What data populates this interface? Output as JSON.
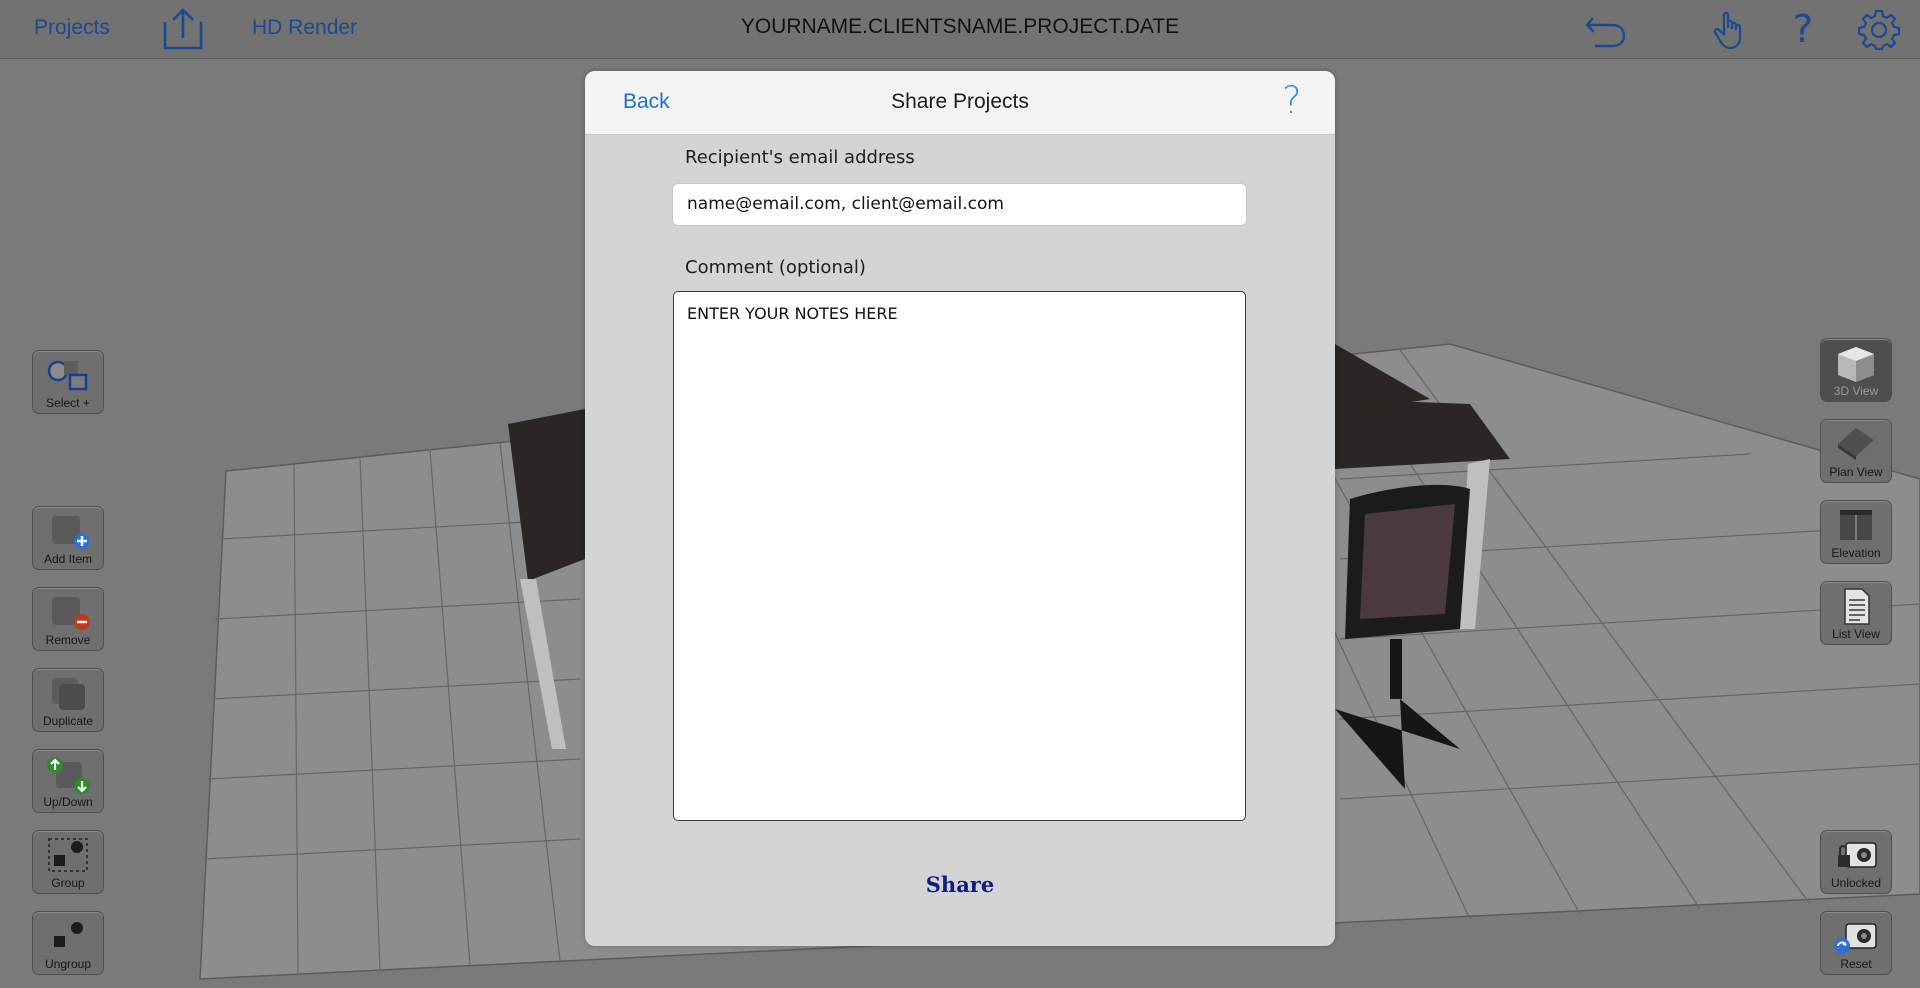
{
  "topbar": {
    "projects_label": "Projects",
    "hd_render_label": "HD Render",
    "project_title": "YOURNAME.CLIENTSNAME.PROJECT.DATE",
    "icons": [
      "export-icon",
      "undo-icon",
      "touch-hand-icon",
      "help-icon",
      "gear-icon"
    ],
    "help_glyph": "?"
  },
  "left_tools": [
    {
      "label": "Select +",
      "icon": "select-shapes-icon"
    },
    {
      "label": "Add Item",
      "icon": "add-item-icon"
    },
    {
      "label": "Remove",
      "icon": "remove-item-icon"
    },
    {
      "label": "Duplicate",
      "icon": "duplicate-icon"
    },
    {
      "label": "Up/Down",
      "icon": "up-down-icon"
    },
    {
      "label": "Group",
      "icon": "group-icon"
    },
    {
      "label": "Ungroup",
      "icon": "ungroup-icon"
    }
  ],
  "right_tools": [
    {
      "label": "3D View",
      "icon": "cube-icon",
      "active": true
    },
    {
      "label": "Plan View",
      "icon": "plan-icon"
    },
    {
      "label": "Elevation",
      "icon": "elevation-icon"
    },
    {
      "label": "List View",
      "icon": "document-icon"
    },
    {
      "label": "Unlocked",
      "icon": "camera-unlocked-icon"
    },
    {
      "label": "Reset",
      "icon": "camera-reset-icon"
    }
  ],
  "modal": {
    "back_label": "Back",
    "title": "Share Projects",
    "help_glyph": "?",
    "email_label": "Recipient's email address",
    "email_value": "name@email.com, client@email.com",
    "comment_label": "Comment (optional)",
    "comment_value": "ENTER YOUR NOTES HERE",
    "share_label": "Share"
  },
  "colors": {
    "link_blue": "#1a6fd3",
    "share_navy": "#101a8a",
    "backdrop_gray": "#7a7a7a",
    "modal_gray": "#d4d4d4"
  }
}
